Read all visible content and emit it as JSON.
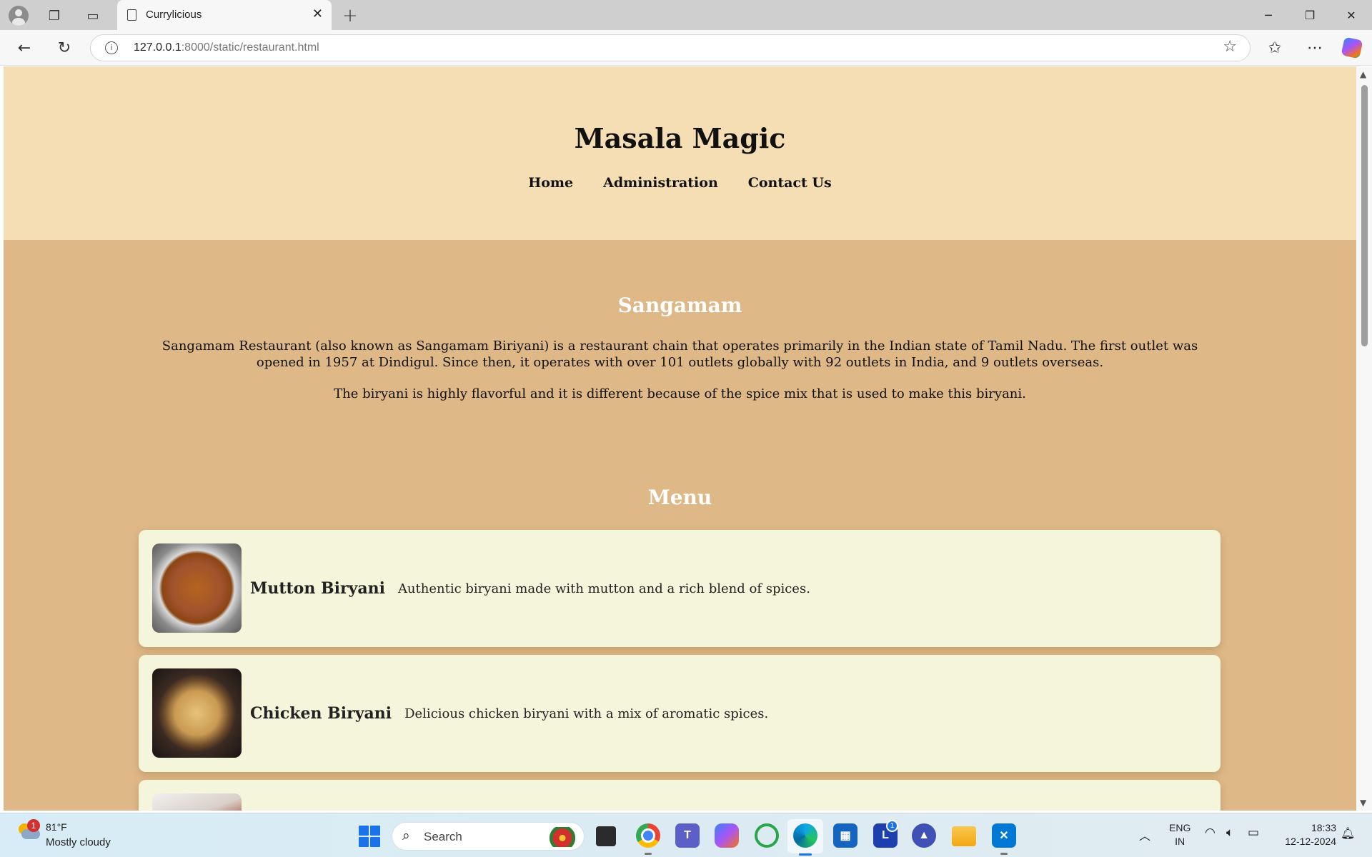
{
  "browser": {
    "tab_title": "Currylicious",
    "url_host": "127.0.0.1",
    "url_path": ":8000/static/restaurant.html"
  },
  "site": {
    "title": "Masala Magic",
    "nav": [
      "Home",
      "Administration",
      "Contact Us"
    ]
  },
  "about": {
    "title": "Sangamam",
    "paragraphs": [
      "Sangamam Restaurant (also known as Sangamam Biriyani) is a restaurant chain that operates primarily in the Indian state of Tamil Nadu. The first outlet was opened in 1957 at Dindigul. Since then, it operates with over 101 outlets globally with 92 outlets in India, and 9 outlets overseas.",
      "The biryani is highly flavorful and it is different because of the spice mix that is used to make this biryani."
    ]
  },
  "menu": {
    "title": "Menu",
    "items": [
      {
        "name": "Mutton Biryani",
        "description": "Authentic biryani made with mutton and a rich blend of spices."
      },
      {
        "name": "Chicken Biryani",
        "description": "Delicious chicken biryani with a mix of aromatic spices."
      }
    ]
  },
  "taskbar": {
    "weather_temp": "81°F",
    "weather_desc": "Mostly cloudy",
    "weather_badge": "1",
    "search_label": "Search",
    "l_app_badge": "1",
    "lang_line1": "ENG",
    "lang_line2": "IN",
    "time": "18:33",
    "date": "12-12-2024"
  },
  "icons": {
    "profile": "profile-icon",
    "workspaces": "workspaces-icon",
    "tab_actions": "tab-actions-icon",
    "back": "back-arrow-icon",
    "refresh": "refresh-icon",
    "info": "info-icon",
    "favorite": "star-icon",
    "favorites": "favorites-icon",
    "more": "more-icon",
    "copilot": "copilot-icon"
  },
  "colors": {
    "header_bg": "#f5deb3",
    "page_bg": "#deb887",
    "card_bg": "#f5f5dc"
  }
}
